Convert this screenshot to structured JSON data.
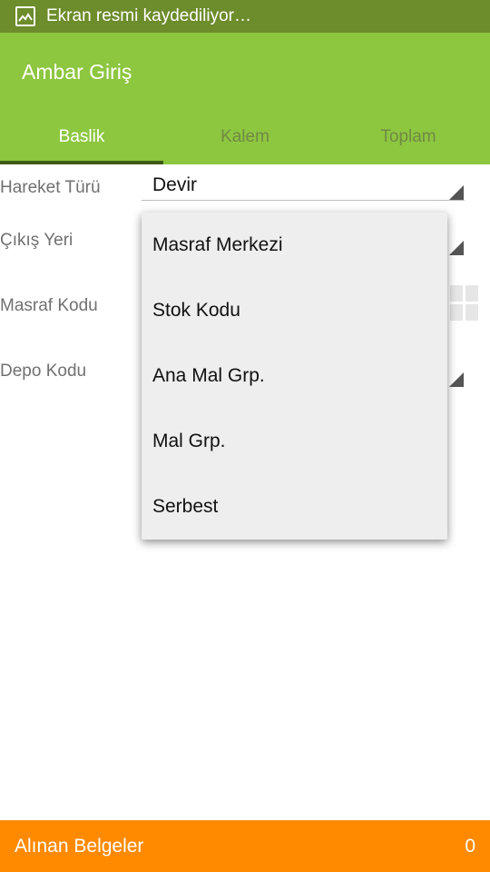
{
  "status_bar": {
    "text": "Ekran resmi kaydediliyor…",
    "icon": "image-icon"
  },
  "app_bar": {
    "title": "Ambar Giriş",
    "color": "#8dc63f"
  },
  "tabs": [
    {
      "label": "Baslik",
      "active": true
    },
    {
      "label": "Kalem",
      "active": false
    },
    {
      "label": "Toplam",
      "active": false
    }
  ],
  "form": {
    "hareket_turu": {
      "label": "Hareket Türü",
      "value": "Devir"
    },
    "cikis_yeri": {
      "label": "Çıkış Yeri"
    },
    "masraf_kodu": {
      "label": "Masraf Kodu"
    },
    "depo_kodu": {
      "label": "Depo Kodu"
    }
  },
  "dropdown": {
    "options": [
      "Masraf Merkezi",
      "Stok Kodu",
      "Ana Mal Grp.",
      "Mal Grp.",
      "Serbest"
    ]
  },
  "bottom_bar": {
    "label": "Alınan Belgeler",
    "count": "0",
    "color": "#ff8a00"
  }
}
